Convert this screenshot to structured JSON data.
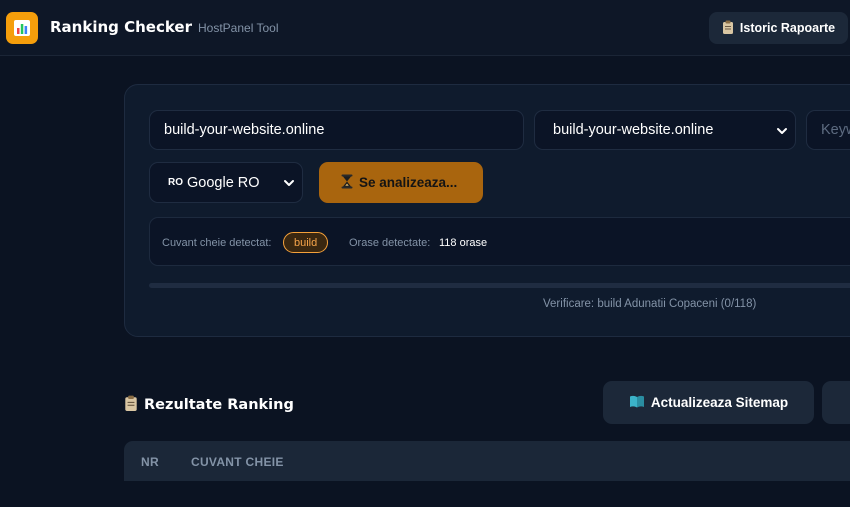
{
  "header": {
    "logo_icon": "bar-chart-icon",
    "title": "Ranking Checker",
    "subtitle": "HostPanel Tool",
    "history_button": {
      "icon": "clipboard-icon",
      "label": "Istoric Rapoarte"
    }
  },
  "form": {
    "domain_input": {
      "value": "build-your-website.online"
    },
    "domain_select": {
      "selected": "build-your-website.online"
    },
    "keyword_input": {
      "placeholder": "Keyw"
    },
    "engine_select": {
      "flag": "RO",
      "selected": "Google RO"
    },
    "analyze_button": {
      "icon": "hourglass-icon",
      "label": "Se analizeaza..."
    }
  },
  "detection": {
    "keyword_label": "Cuvant cheie detectat:",
    "keyword_value": "build",
    "cities_label": "Orase detectate:",
    "cities_value": "118 orase"
  },
  "progress": {
    "fraction": 0,
    "text": "Verificare: build Adunatii Copaceni (0/118)"
  },
  "results": {
    "title_icon": "clipboard-icon",
    "title": "Rezultate Ranking",
    "sitemap_button": {
      "icon": "book-icon",
      "label": "Actualizeaza Sitemap"
    },
    "columns": [
      "NR",
      "CUVANT CHEIE"
    ]
  },
  "colors": {
    "accent": "#f59e0b",
    "analyze_button": "#a9650e",
    "background": "#0b1322",
    "card": "#0f1b2d"
  }
}
